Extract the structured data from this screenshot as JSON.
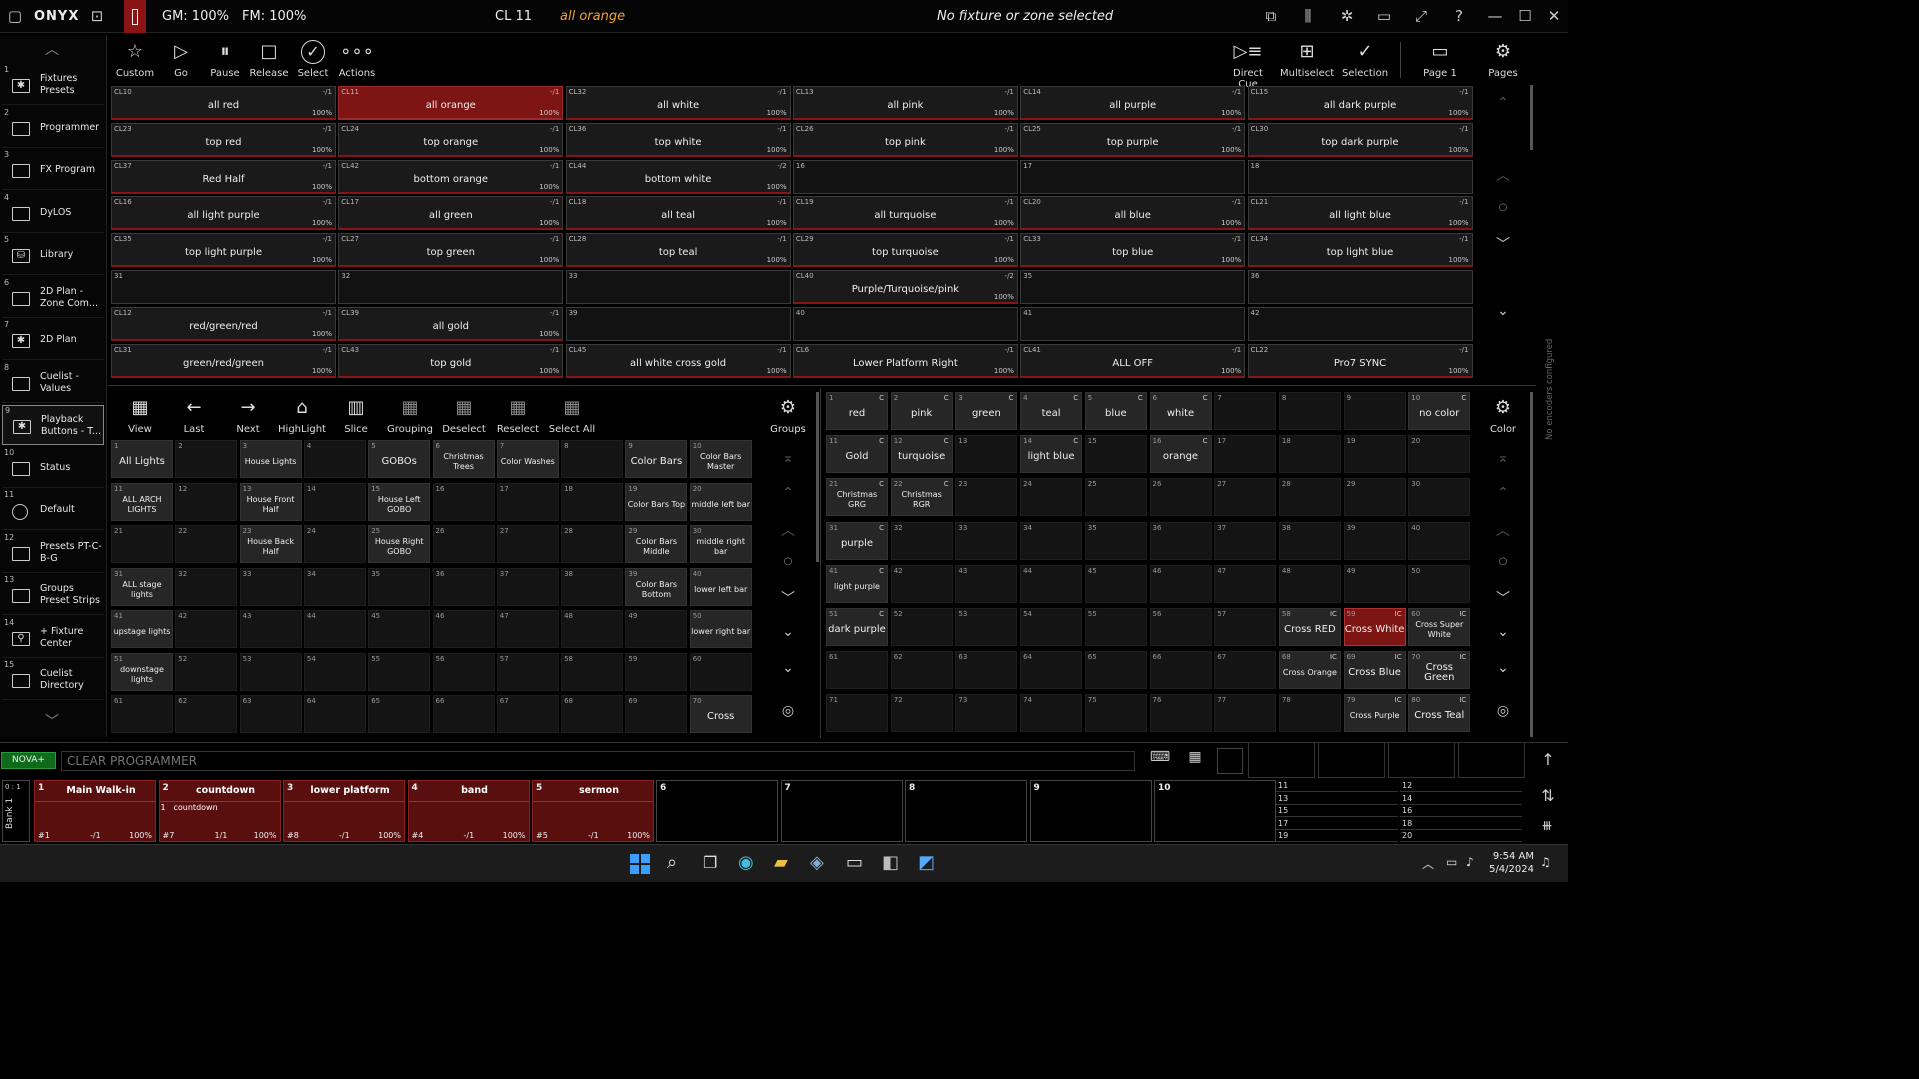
{
  "topbar": {
    "brand": "ONYX",
    "gm": "GM: 100%",
    "fm": "FM: 100%",
    "cl_prefix": "CL 11",
    "cl_name": "all orange",
    "selection": "No fixture or zone selected"
  },
  "sidebar": [
    {
      "num": "1",
      "label": "Fixtures Presets",
      "icon": "asterisk-icon"
    },
    {
      "num": "2",
      "label": "Programmer",
      "icon": "square-icon"
    },
    {
      "num": "3",
      "label": "FX Program",
      "icon": "square-icon"
    },
    {
      "num": "4",
      "label": "DyLOS",
      "icon": "square-icon"
    },
    {
      "num": "5",
      "label": "Library",
      "icon": "library-icon"
    },
    {
      "num": "6",
      "label": "2D Plan - Zone Com...",
      "icon": "square-icon"
    },
    {
      "num": "7",
      "label": "2D Plan",
      "icon": "asterisk-icon"
    },
    {
      "num": "8",
      "label": "Cuelist - Values",
      "icon": "square-icon"
    },
    {
      "num": "9",
      "label": "Playback Buttons - T...",
      "icon": "asterisk-icon"
    },
    {
      "num": "10",
      "label": "Status",
      "icon": "square-icon"
    },
    {
      "num": "11",
      "label": "Default",
      "icon": "circle-icon"
    },
    {
      "num": "12",
      "label": "Presets PT-C-B-G",
      "icon": "square-icon"
    },
    {
      "num": "13",
      "label": "Groups Preset Strips",
      "icon": "square-icon"
    },
    {
      "num": "14",
      "label": "+ Fixture Center",
      "icon": "fixture-icon"
    },
    {
      "num": "15",
      "label": "Cuelist Directory",
      "icon": "square-icon"
    }
  ],
  "toolbar": {
    "left": [
      "Custom",
      "Go",
      "Pause",
      "Release",
      "Select",
      "Actions"
    ],
    "right": [
      "Direct Cue",
      "Multiselect",
      "Selection",
      "Page 1",
      "Pages"
    ]
  },
  "cues": [
    [
      [
        "CL10",
        "-/1",
        "all red",
        "100%"
      ],
      [
        "CL11",
        "-/1",
        "all orange",
        "100%"
      ],
      [
        "CL32",
        "-/1",
        "all white",
        "100%"
      ],
      [
        "CL13",
        "-/1",
        "all pink",
        "100%"
      ],
      [
        "CL14",
        "-/1",
        "all purple",
        "100%"
      ],
      [
        "CL15",
        "-/1",
        "all dark purple",
        "100%"
      ]
    ],
    [
      [
        "CL23",
        "-/1",
        "top red",
        "100%"
      ],
      [
        "CL24",
        "-/1",
        "top orange",
        "100%"
      ],
      [
        "CL36",
        "-/1",
        "top white",
        "100%"
      ],
      [
        "CL26",
        "-/1",
        "top pink",
        "100%"
      ],
      [
        "CL25",
        "-/1",
        "top purple",
        "100%"
      ],
      [
        "CL30",
        "-/1",
        "top dark purple",
        "100%"
      ]
    ],
    [
      [
        "CL37",
        "-/1",
        "Red Half",
        "100%"
      ],
      [
        "CL42",
        "-/1",
        "bottom orange",
        "100%"
      ],
      [
        "CL44",
        "-/2",
        "bottom white",
        "100%"
      ],
      [
        "16",
        "",
        "",
        ""
      ],
      [
        "17",
        "",
        "",
        ""
      ],
      [
        "18",
        "",
        "",
        ""
      ]
    ],
    [
      [
        "CL16",
        "-/1",
        "all light purple",
        "100%"
      ],
      [
        "CL17",
        "-/1",
        "all green",
        "100%"
      ],
      [
        "CL18",
        "-/1",
        "all teal",
        "100%"
      ],
      [
        "CL19",
        "-/1",
        "all turquoise",
        "100%"
      ],
      [
        "CL20",
        "-/1",
        "all blue",
        "100%"
      ],
      [
        "CL21",
        "-/1",
        "all light blue",
        "100%"
      ]
    ],
    [
      [
        "CL35",
        "-/1",
        "top light purple",
        "100%"
      ],
      [
        "CL27",
        "-/1",
        "top green",
        "100%"
      ],
      [
        "CL28",
        "-/1",
        "top teal",
        "100%"
      ],
      [
        "CL29",
        "-/1",
        "top turquoise",
        "100%"
      ],
      [
        "CL33",
        "-/1",
        "top blue",
        "100%"
      ],
      [
        "CL34",
        "-/1",
        "top light blue",
        "100%"
      ]
    ],
    [
      [
        "31",
        "",
        "",
        ""
      ],
      [
        "32",
        "",
        "",
        ""
      ],
      [
        "33",
        "",
        "",
        ""
      ],
      [
        "CL40",
        "-/2",
        "Purple/Turquoise/pink",
        "100%"
      ],
      [
        "35",
        "",
        "",
        ""
      ],
      [
        "36",
        "",
        "",
        ""
      ]
    ],
    [
      [
        "CL12",
        "-/1",
        "red/green/red",
        "100%"
      ],
      [
        "CL39",
        "-/1",
        "all gold",
        "100%"
      ],
      [
        "39",
        "",
        "",
        ""
      ],
      [
        "40",
        "",
        "",
        ""
      ],
      [
        "41",
        "",
        "",
        ""
      ],
      [
        "42",
        "",
        "",
        ""
      ]
    ],
    [
      [
        "CL31",
        "-/1",
        "green/red/green",
        "100%"
      ],
      [
        "CL43",
        "-/1",
        "top gold",
        "100%"
      ],
      [
        "CL45",
        "-/1",
        "all white cross gold",
        "100%"
      ],
      [
        "CL6",
        "-/1",
        "Lower Platform Right",
        "100%"
      ],
      [
        "CL41",
        "-/1",
        "ALL OFF",
        "100%"
      ],
      [
        "CL22",
        "-/1",
        "Pro7 SYNC",
        "100%"
      ]
    ]
  ],
  "groups_toolbar": [
    "View",
    "Last",
    "Next",
    "HighLight",
    "Slice",
    "Grouping",
    "Deselect",
    "Reselect",
    "Select All"
  ],
  "groups_label": "Groups",
  "groups": {
    "1": "All Lights",
    "3": "House Lights",
    "5": "GOBOs",
    "6": "Christmas Trees",
    "7": "Color Washes",
    "9": "Color Bars",
    "10": "Color Bars Master",
    "11": "ALL ARCH LIGHTS",
    "13": "House Front Half",
    "15": "House Left GOBO",
    "19": "Color Bars Top",
    "20": "middle left bar",
    "23": "House Back Half",
    "25": "House Right GOBO",
    "29": "Color Bars Middle",
    "30": "middle right bar",
    "31": "ALL stage lights",
    "39": "Color Bars Bottom",
    "40": "lower left bar",
    "41": "upstage lights",
    "50": "lower right bar",
    "51": "downstage lights",
    "70": "Cross"
  },
  "color_label": "Color",
  "colors": {
    "1": "red",
    "2": "pink",
    "3": "green",
    "4": "teal",
    "5": "blue",
    "6": "white",
    "10": "no color",
    "11": "Gold",
    "12": "turquoise",
    "14": "light blue",
    "16": "orange",
    "21": "Christmas GRG",
    "22": "Christmas RGR",
    "31": "purple",
    "41": "light purple",
    "51": "dark purple",
    "58": "Cross RED",
    "59": "Cross White",
    "60": "Cross Super White",
    "68": "Cross Orange",
    "69": "Cross Blue",
    "70": "Cross Green",
    "79": "Cross Purple",
    "80": "Cross Teal"
  },
  "encoders_text": "No encoders configured",
  "command": {
    "nova": "NOVA+",
    "placeholder": "CLEAR PROGRAMMER"
  },
  "bank": {
    "label": "Bank 1",
    "ratio": "0 : 1"
  },
  "playbacks": [
    {
      "num": "1",
      "title": "Main Walk-in",
      "sub": "",
      "subl": "",
      "fnum": "#1",
      "count": "-/1",
      "pct": "100%"
    },
    {
      "num": "2",
      "title": "countdown",
      "sub": "1",
      "subl": "countdown",
      "fnum": "#7",
      "count": "1/1",
      "pct": "100%"
    },
    {
      "num": "3",
      "title": "lower platform",
      "sub": "",
      "subl": "",
      "fnum": "#8",
      "count": "-/1",
      "pct": "100%"
    },
    {
      "num": "4",
      "title": "band",
      "sub": "",
      "subl": "",
      "fnum": "#4",
      "count": "-/1",
      "pct": "100%"
    },
    {
      "num": "5",
      "title": "sermon",
      "sub": "",
      "subl": "",
      "fnum": "#5",
      "count": "-/1",
      "pct": "100%"
    }
  ],
  "empty_playbacks": [
    "6",
    "7",
    "8",
    "9",
    "10"
  ],
  "mini_playbacks": [
    "11",
    "12",
    "13",
    "14",
    "15",
    "16",
    "17",
    "18",
    "19",
    "20"
  ],
  "taskbar": {
    "time": "9:54 AM",
    "date": "5/4/2024"
  }
}
